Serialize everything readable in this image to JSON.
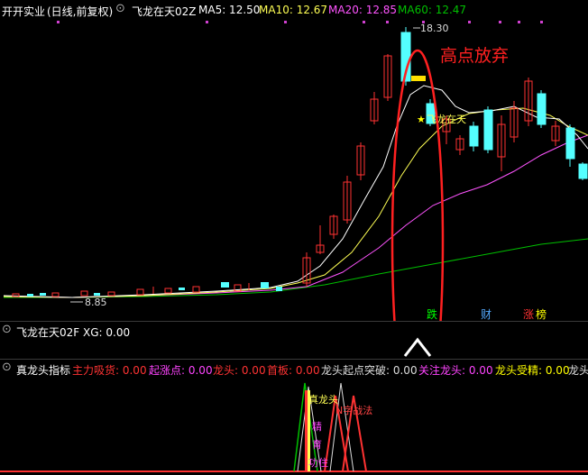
{
  "top_bar": {
    "stock_name": "开开实业",
    "period": "(日线,前复权)",
    "indicator_label": "飞龙在天02Z",
    "ma5_label": "MA5: 12.50",
    "ma10_label": "MA10: 12.67",
    "ma20_label": "MA20: 12.85",
    "ma60_label": "MA60: 12.47"
  },
  "main_chart": {
    "annotation": "高点放弃",
    "high_label": "18.30",
    "low_label": "8.85",
    "signal_label": "飞龙在天",
    "bottom_badges": [
      "跌",
      "财",
      "涨",
      "榜"
    ]
  },
  "panel2": {
    "title": "飞龙在天02F XG: 0.00"
  },
  "panel3": {
    "title": "真龙头指标",
    "values": [
      {
        "text": "主力吸货: 0.00",
        "color": "#ff3333"
      },
      {
        "text": "起涨点: 0.00",
        "color": "#ff44ff"
      },
      {
        "text": "龙头: 0.00",
        "color": "#ff3333"
      },
      {
        "text": "首板: 0.00",
        "color": "#ff3333"
      },
      {
        "text": "龙头起点突破: 0.00",
        "color": "#dddddd"
      },
      {
        "text": "关注龙头: 0.00",
        "color": "#ff44ff"
      },
      {
        "text": "龙头受精: 0.00",
        "color": "#ffff00"
      },
      {
        "text": "龙头",
        "color": "#dddddd"
      }
    ],
    "chart_labels": {
      "zhenlongtou": "真龙头",
      "nzi": "N字战法",
      "label_a": "精",
      "label_b": "育",
      "label_c": "功住"
    }
  },
  "colors": {
    "up": "#ff3232",
    "down": "#54ffff",
    "ma5": "#ffffff",
    "ma10": "#ffff54",
    "ma20": "#ff54ff",
    "ma60": "#00c000",
    "annotation": "#ff2020"
  }
}
